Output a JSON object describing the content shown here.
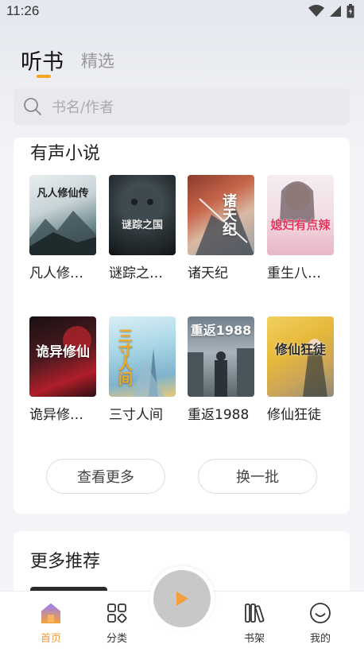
{
  "status_bar": {
    "time": "11:26"
  },
  "header": {
    "tabs": [
      {
        "label": "听书",
        "active": true
      },
      {
        "label": "精选",
        "active": false
      }
    ]
  },
  "search": {
    "placeholder": "书名/作者"
  },
  "audio_section": {
    "title": "有声小说",
    "books": [
      {
        "name": "凡人修…",
        "cover_text": "凡人修仙传"
      },
      {
        "name": "谜踪之…",
        "cover_text": "谜踪之国"
      },
      {
        "name": "诸天纪",
        "cover_text": "诸天纪"
      },
      {
        "name": "重生八…",
        "cover_text": "媳妇有点辣"
      },
      {
        "name": "诡异修…",
        "cover_text": "诡异修仙"
      },
      {
        "name": "三寸人间",
        "cover_text": "三寸人间"
      },
      {
        "name": "重返1988",
        "cover_text": "重返1988"
      },
      {
        "name": "修仙狂徒",
        "cover_text": "修仙狂徒"
      }
    ],
    "more_button": "查看更多",
    "change_button": "换一批"
  },
  "more_section": {
    "title": "更多推荐"
  },
  "bottom_nav": {
    "items": [
      {
        "label": "首页",
        "icon": "home-icon",
        "active": true
      },
      {
        "label": "分类",
        "icon": "category-icon",
        "active": false
      },
      {
        "label": "书架",
        "icon": "bookshelf-icon",
        "active": false
      },
      {
        "label": "我的",
        "icon": "profile-icon",
        "active": false
      }
    ]
  },
  "colors": {
    "accent": "#f29a3b",
    "indicator": "#f5a623",
    "background": "#f3f4f7"
  }
}
